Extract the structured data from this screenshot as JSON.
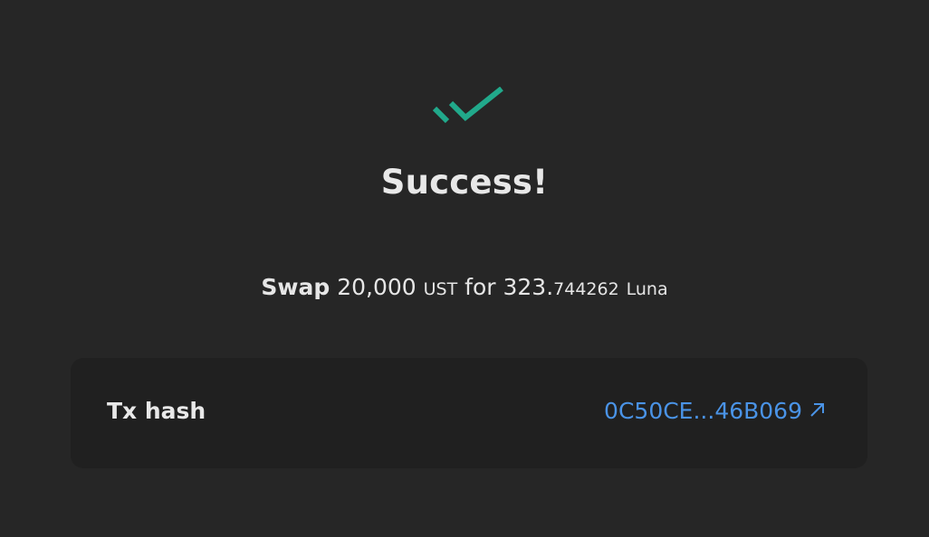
{
  "status": {
    "icon": "double-check-icon",
    "icon_color": "#21a98b",
    "title": "Success!"
  },
  "summary": {
    "verb": "Swap",
    "amount_in": "20,000",
    "unit_in": "UST",
    "connector": "for",
    "amount_out_int": "323.",
    "amount_out_dec": "744262",
    "unit_out": "Luna"
  },
  "tx": {
    "label": "Tx hash",
    "hash": "0C50CE...46B069",
    "link_icon": "external-link-arrow-icon",
    "link_color": "#4a93e6"
  }
}
